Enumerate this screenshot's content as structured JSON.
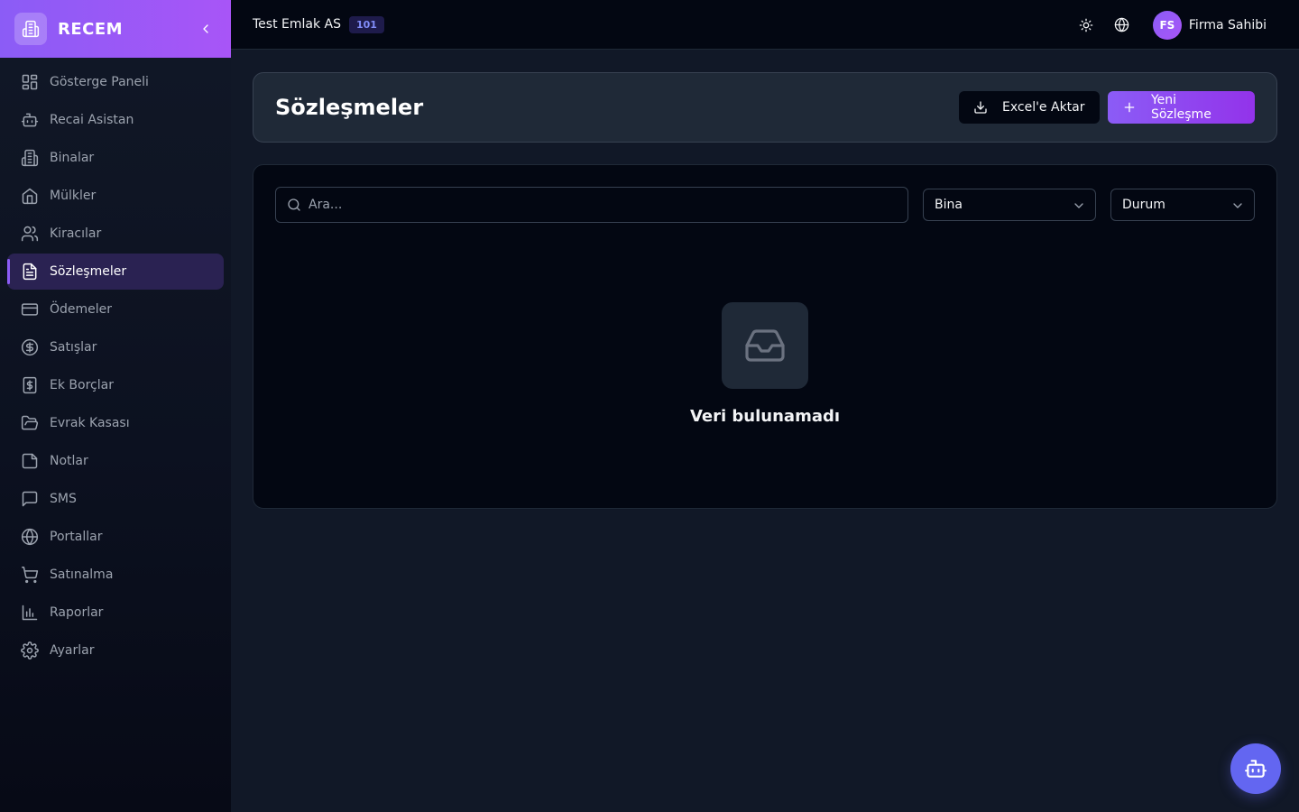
{
  "brand": {
    "name": "RECEM"
  },
  "sidebar": {
    "items": [
      {
        "label": "Gösterge Paneli",
        "icon": "dashboard-icon"
      },
      {
        "label": "Recai Asistan",
        "icon": "bot-icon"
      },
      {
        "label": "Binalar",
        "icon": "building-icon"
      },
      {
        "label": "Mülkler",
        "icon": "home-icon"
      },
      {
        "label": "Kiracılar",
        "icon": "users-icon"
      },
      {
        "label": "Sözleşmeler",
        "icon": "file-text-icon",
        "active": true
      },
      {
        "label": "Ödemeler",
        "icon": "credit-card-icon"
      },
      {
        "label": "Satışlar",
        "icon": "dollar-circle-icon"
      },
      {
        "label": "Ek Borçlar",
        "icon": "receipt-icon"
      },
      {
        "label": "Evrak Kasası",
        "icon": "folder-open-icon"
      },
      {
        "label": "Notlar",
        "icon": "sticky-note-icon"
      },
      {
        "label": "SMS",
        "icon": "message-icon"
      },
      {
        "label": "Portallar",
        "icon": "globe-icon"
      },
      {
        "label": "Satınalma",
        "icon": "cart-icon"
      },
      {
        "label": "Raporlar",
        "icon": "bar-chart-icon"
      },
      {
        "label": "Ayarlar",
        "icon": "gear-icon"
      }
    ]
  },
  "topbar": {
    "company": "Test Emlak AS",
    "company_badge": "101",
    "user": {
      "initials": "FS",
      "name": "Firma Sahibi"
    }
  },
  "page": {
    "title": "Sözleşmeler",
    "export_label": "Excel'e Aktar",
    "new_label": "Yeni Sözleşme"
  },
  "filters": {
    "search_placeholder": "Ara...",
    "building_select": "Bina",
    "status_select": "Durum"
  },
  "empty_state": {
    "text": "Veri bulunamadı"
  },
  "colors": {
    "accent": "#8b5cf6",
    "accent_end": "#a855f7",
    "fab": "#6366f1",
    "background": "#111827",
    "card": "#1f2937",
    "panel": "#030712"
  }
}
